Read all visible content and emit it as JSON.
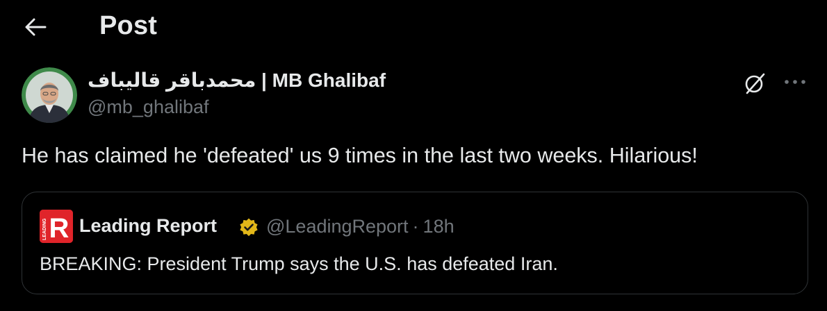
{
  "header": {
    "title": "Post",
    "back_icon": "arrow-left-icon"
  },
  "post": {
    "author": {
      "display_name": "محمدباقر قالیباف | MB Ghalibaf",
      "handle": "@mb_ghalibaf"
    },
    "text": "He has claimed he 'defeated' us 9 times in the last two weeks. Hilarious!",
    "actions": {
      "grok_icon": "grok-icon",
      "more_icon": "more-horizontal-icon"
    }
  },
  "quote": {
    "author": {
      "display_name": "Leading Report",
      "avatar_letter": "R",
      "avatar_small_text": "LEADING",
      "verified": "gold-verified-badge-icon",
      "handle": "@LeadingReport",
      "separator": "·",
      "time": "18h"
    },
    "text": "BREAKING: President Trump says the U.S. has defeated Iran."
  },
  "colors": {
    "background": "#000000",
    "primary_text": "#e7e9ea",
    "secondary_text": "#71767b",
    "border": "#2f3336",
    "verified_gold": "#e2b719",
    "leading_report_red": "#e0242a"
  }
}
